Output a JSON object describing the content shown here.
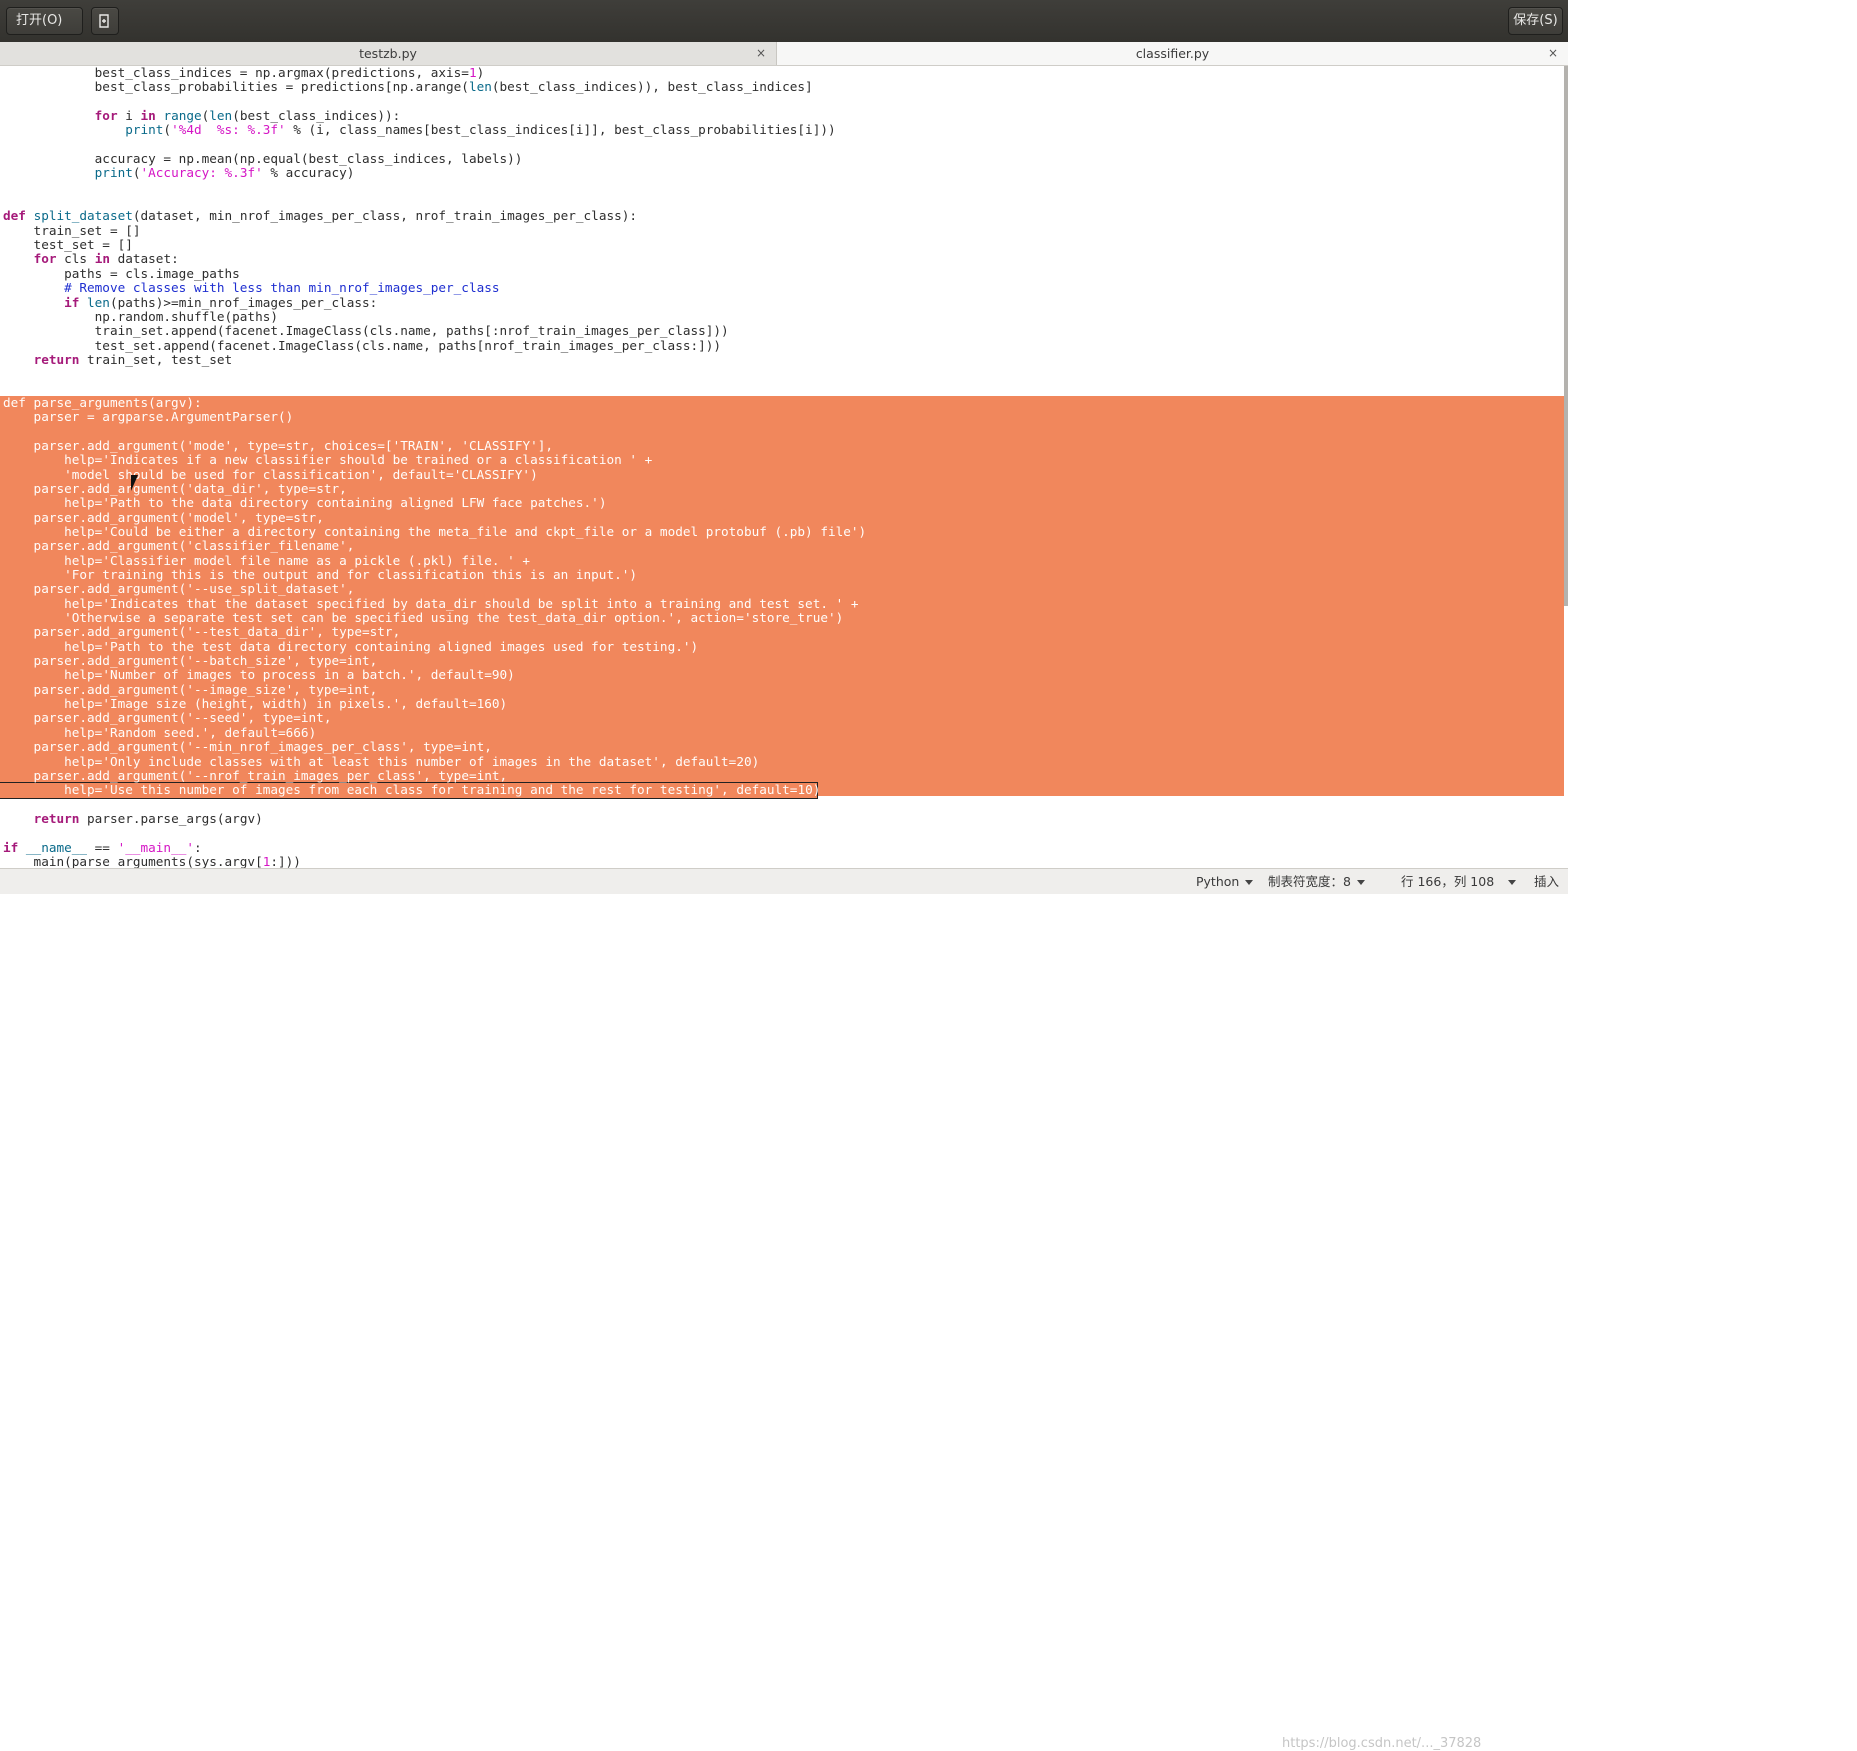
{
  "headerbar": {
    "open_label": "打开(O)",
    "save_label": "保存(S)",
    "new_icon": "new-document-icon"
  },
  "tabs": [
    {
      "label": "testzb.py",
      "close": "×"
    },
    {
      "label": "classifier.py",
      "close": "×"
    }
  ],
  "editor": {
    "language": "python",
    "selection_color": "#f1875c",
    "lines": [
      {
        "t": "            best_class_indices = np.argmax(predictions, axis=1)"
      },
      {
        "t": "            best_class_probabilities = predictions[np.arange(len(best_class_indices)), best_class_indices]"
      },
      {
        "t": ""
      },
      {
        "t": "            for i in range(len(best_class_indices)):"
      },
      {
        "t": "                print('%4d  %s: %.3f' % (i, class_names[best_class_indices[i]], best_class_probabilities[i]))"
      },
      {
        "t": ""
      },
      {
        "t": "            accuracy = np.mean(np.equal(best_class_indices, labels))"
      },
      {
        "t": "            print('Accuracy: %.3f' % accuracy)"
      },
      {
        "t": ""
      },
      {
        "t": ""
      },
      {
        "t": "def split_dataset(dataset, min_nrof_images_per_class, nrof_train_images_per_class):"
      },
      {
        "t": "    train_set = []"
      },
      {
        "t": "    test_set = []"
      },
      {
        "t": "    for cls in dataset:"
      },
      {
        "t": "        paths = cls.image_paths"
      },
      {
        "t": "        # Remove classes with less than min_nrof_images_per_class"
      },
      {
        "t": "        if len(paths)>=min_nrof_images_per_class:"
      },
      {
        "t": "            np.random.shuffle(paths)"
      },
      {
        "t": "            train_set.append(facenet.ImageClass(cls.name, paths[:nrof_train_images_per_class]))"
      },
      {
        "t": "            test_set.append(facenet.ImageClass(cls.name, paths[nrof_train_images_per_class:]))"
      },
      {
        "t": "    return train_set, test_set"
      },
      {
        "t": ""
      },
      {
        "t": ""
      },
      {
        "t": "def parse_arguments(argv):",
        "sel": true
      },
      {
        "t": "    parser = argparse.ArgumentParser()",
        "sel": true
      },
      {
        "t": "",
        "sel": true
      },
      {
        "t": "    parser.add_argument('mode', type=str, choices=['TRAIN', 'CLASSIFY'],",
        "sel": true
      },
      {
        "t": "        help='Indicates if a new classifier should be trained or a classification ' +",
        "sel": true
      },
      {
        "t": "        'model should be used for classification', default='CLASSIFY')",
        "sel": true
      },
      {
        "t": "    parser.add_argument('data_dir', type=str,",
        "sel": true
      },
      {
        "t": "        help='Path to the data directory containing aligned LFW face patches.')",
        "sel": true
      },
      {
        "t": "    parser.add_argument('model', type=str,",
        "sel": true
      },
      {
        "t": "        help='Could be either a directory containing the meta_file and ckpt_file or a model protobuf (.pb) file')",
        "sel": true
      },
      {
        "t": "    parser.add_argument('classifier_filename',",
        "sel": true
      },
      {
        "t": "        help='Classifier model file name as a pickle (.pkl) file. ' +",
        "sel": true
      },
      {
        "t": "        'For training this is the output and for classification this is an input.')",
        "sel": true
      },
      {
        "t": "    parser.add_argument('--use_split_dataset',",
        "sel": true
      },
      {
        "t": "        help='Indicates that the dataset specified by data_dir should be split into a training and test set. ' +",
        "sel": true
      },
      {
        "t": "        'Otherwise a separate test set can be specified using the test_data_dir option.', action='store_true')",
        "sel": true
      },
      {
        "t": "    parser.add_argument('--test_data_dir', type=str,",
        "sel": true
      },
      {
        "t": "        help='Path to the test data directory containing aligned images used for testing.')",
        "sel": true
      },
      {
        "t": "    parser.add_argument('--batch_size', type=int,",
        "sel": true
      },
      {
        "t": "        help='Number of images to process in a batch.', default=90)",
        "sel": true
      },
      {
        "t": "    parser.add_argument('--image_size', type=int,",
        "sel": true
      },
      {
        "t": "        help='Image size (height, width) in pixels.', default=160)",
        "sel": true
      },
      {
        "t": "    parser.add_argument('--seed', type=int,",
        "sel": true
      },
      {
        "t": "        help='Random seed.', default=666)",
        "sel": true
      },
      {
        "t": "    parser.add_argument('--min_nrof_images_per_class', type=int,",
        "sel": true
      },
      {
        "t": "        help='Only include classes with at least this number of images in the dataset', default=20)",
        "sel": true
      },
      {
        "t": "    parser.add_argument('--nrof_train_images_per_class', type=int,",
        "sel": true
      },
      {
        "t": "        help='Use this number of images from each class for training and the rest for testing', default=10)",
        "sel": true
      },
      {
        "t": ""
      },
      {
        "t": "    return parser.parse_args(argv)"
      },
      {
        "t": ""
      },
      {
        "t": "if __name__ == '__main__':"
      },
      {
        "t": "    main(parse_arguments(sys.argv[1:]))"
      }
    ]
  },
  "statusbar": {
    "language": "Python",
    "tab_width": "制表符宽度：8",
    "position": "行 166，列 108",
    "mode": "插入",
    "watermark": "https://blog.csdn.net/..._37828"
  }
}
